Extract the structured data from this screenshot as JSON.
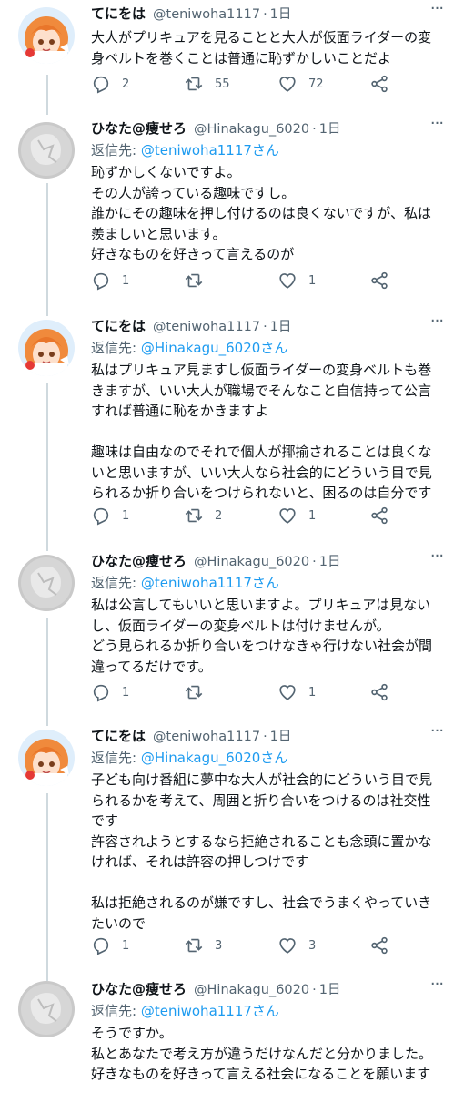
{
  "tweets": [
    {
      "name": "てにをは",
      "handle": "@teniwoha1117",
      "time": "1日",
      "reply_to": null,
      "text": "大人がプリキュアを見ることと大人が仮面ライダーの変\n身ベルトを巻くことは普通に恥ずかしいことだよ",
      "replies": "2",
      "retweets": "55",
      "likes": "72",
      "avatar": "anime-avatar"
    },
    {
      "name": "ひなた@痩せろ",
      "handle": "@Hinakagu_6020",
      "time": "1日",
      "reply_to": "@teniwoha1117さん",
      "text": "恥ずかしくないですよ。\nその人が誇っている趣味ですし。\n誰かにその趣味を押し付けるのは良くないですが、私は\n羨ましいと思います。\n好きなものを好きって言えるのが",
      "replies": "1",
      "retweets": "",
      "likes": "1",
      "avatar": "gray-avatar"
    },
    {
      "name": "てにをは",
      "handle": "@teniwoha1117",
      "time": "1日",
      "reply_to": "@Hinakagu_6020さん",
      "text": "私はプリキュア見ますし仮面ライダーの変身ベルトも巻\nきますが、いい大人が職場でそんなこと自信持って公言\nすれば普通に恥をかきますよ\n\n趣味は自由なのでそれで個人が揶揄されることは良くな\nいと思いますが、いい大人なら社会的にどういう目で見\nられるか折り合いをつけられないと、困るのは自分です",
      "replies": "1",
      "retweets": "2",
      "likes": "1",
      "avatar": "anime-avatar"
    },
    {
      "name": "ひなた@痩せろ",
      "handle": "@Hinakagu_6020",
      "time": "1日",
      "reply_to": "@teniwoha1117さん",
      "text": "私は公言してもいいと思いますよ。プリキュアは見ない\nし、仮面ライダーの変身ベルトは付けませんが。\nどう見られるか折り合いをつけなきゃ行けない社会が間\n違ってるだけです。",
      "replies": "1",
      "retweets": "",
      "likes": "1",
      "avatar": "gray-avatar"
    },
    {
      "name": "てにをは",
      "handle": "@teniwoha1117",
      "time": "1日",
      "reply_to": "@Hinakagu_6020さん",
      "text": "子ども向け番組に夢中な大人が社会的にどういう目で見\nられるかを考えて、周囲と折り合いをつけるのは社交性\nです\n許容されようとするなら拒絶されることも念頭に置かな\nければ、それは許容の押しつけです\n\n私は拒絶されるのが嫌ですし、社会でうまくやっていき\nたいので",
      "replies": "1",
      "retweets": "3",
      "likes": "3",
      "avatar": "anime-avatar"
    },
    {
      "name": "ひなた@痩せろ",
      "handle": "@Hinakagu_6020",
      "time": "1日",
      "reply_to": "@teniwoha1117さん",
      "text": "そうですか。\n私とあなたで考え方が違うだけなんだと分かりました。\n好きなものを好きって言える社会になることを願います",
      "replies": "",
      "retweets": "",
      "likes": "",
      "avatar": "gray-avatar"
    }
  ],
  "labels": {
    "reply_prefix": "返信先: ",
    "dot": "·",
    "more": "···"
  },
  "colors": {
    "accent": "#1d9bf0",
    "muted": "#536471",
    "thread_line": "#cfd9de",
    "avatar_orange_hair": "#f08a3c"
  }
}
